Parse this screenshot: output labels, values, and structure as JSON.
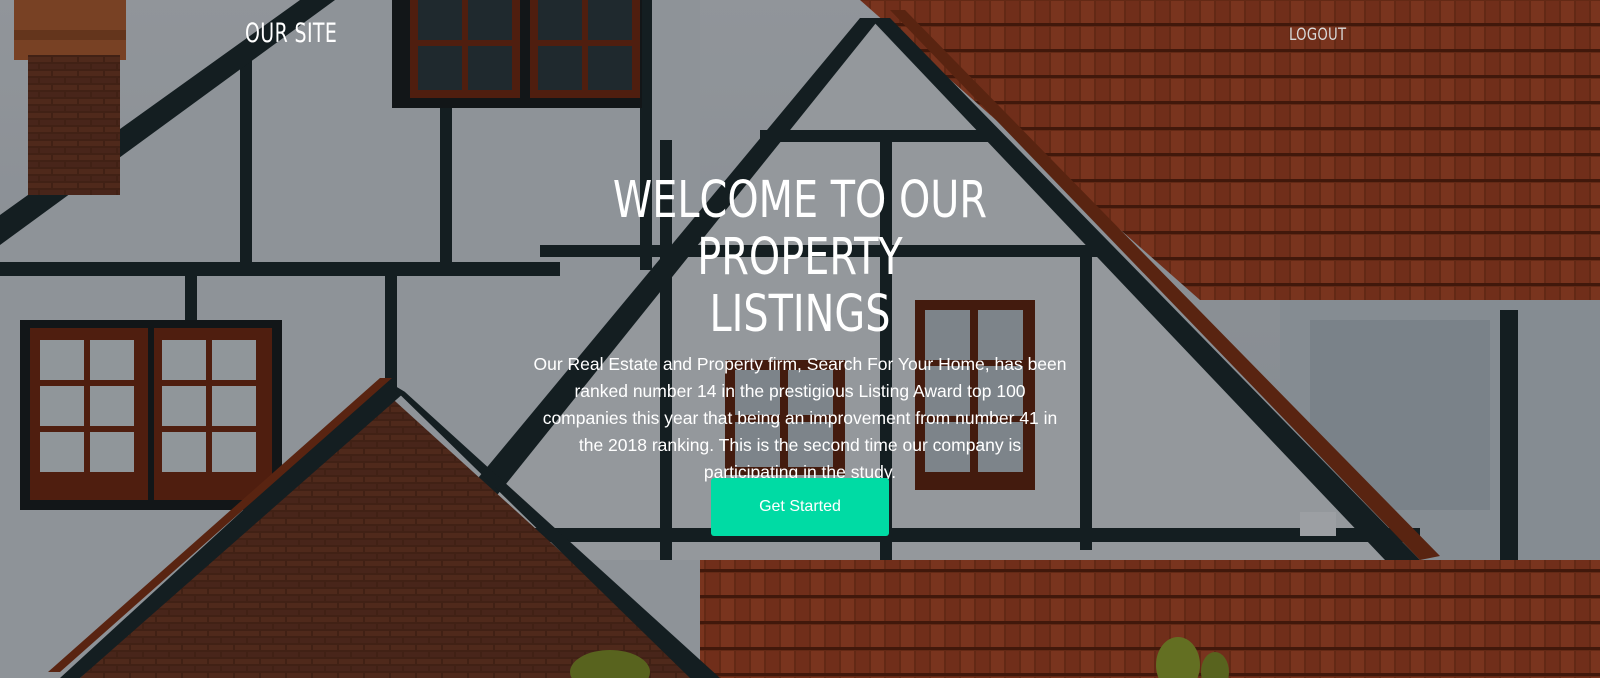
{
  "nav": {
    "brand": "OUR SITE",
    "logout": "LOGOUT"
  },
  "hero": {
    "title": "WELCOME TO OUR PROPERTY\nLISTINGS",
    "description": "Our Real Estate and Property firm, Search For Your Home, has been ranked number 14 in the prestigious Listing Award top 100 companies this year that being an improvement from number 41 in the 2018 ranking. This is the second time our company is participating in the study.",
    "cta_label": "Get Started"
  },
  "colors": {
    "accent": "#00dba4",
    "text": "#ffffff"
  }
}
